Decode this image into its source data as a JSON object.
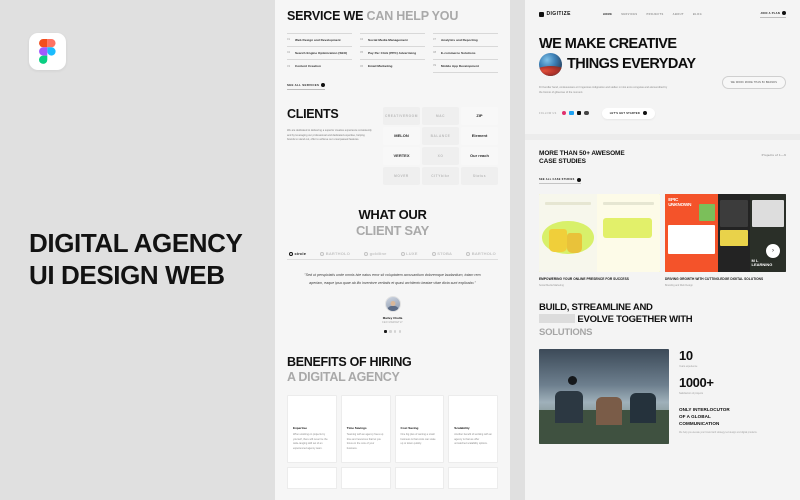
{
  "left": {
    "logo_icon": "figma-icon",
    "title": "DIGITAL AGENCY\nUI DESIGN WEB"
  },
  "mid": {
    "service": {
      "heading_dark": "SERVICE WE",
      "heading_muted": "CAN HELP YOU",
      "items": [
        {
          "num": "01",
          "label": "Web Design and Development"
        },
        {
          "num": "04",
          "label": "Social Media Management"
        },
        {
          "num": "07",
          "label": "Analytics and Reporting"
        },
        {
          "num": "02",
          "label": "Search Engine Optimization (SEO)"
        },
        {
          "num": "05",
          "label": "Pay Per Click (PPC) Advertising"
        },
        {
          "num": "08",
          "label": "E-commerce Solutions"
        },
        {
          "num": "03",
          "label": "Content Creation"
        },
        {
          "num": "06",
          "label": "Email Marketing"
        },
        {
          "num": "09",
          "label": "Mobile App Development"
        }
      ],
      "cta": "SEE ALL SERVICES"
    },
    "clients": {
      "title": "CLIENTS",
      "copy": "We are dedicated to delivering a superior creative experience consistently and by leveraging our professional and dedicated expertise, helping brands to stand out, offer to achieve our unsurpassed features.",
      "logos": [
        "CREATIVEROOM",
        "MAC",
        "ZIP",
        "MELON",
        "BALANCE",
        "Element",
        "VERTEX",
        "XO",
        "Our reach",
        "MOVER",
        "CITYbike",
        "Status"
      ]
    },
    "testimonial": {
      "heading_dark": "WHAT OUR",
      "heading_muted": "CLIENT SAY",
      "logos": [
        "circle",
        "BARTHOLO",
        "goldline",
        "LUXE",
        "STOBA",
        "BARTHOLO"
      ],
      "active_logo": "circle",
      "quote": "\"Sed ut perspiciatis unde omnis iste natus error sit voluptatem accusantium doloremque laudantium, totam rem aperiam, eaque ipsa quae ab illo inventore veritatis et quasi architecto beatae vitae dicta sunt explicabo.\"",
      "name": "Marley Chulla",
      "role": "CEO MARKETLY",
      "dots": 4,
      "active_dot": 0
    },
    "benefits": {
      "heading_dark": "BENEFITS OF HIRING",
      "heading_muted": "A DIGITAL AGENCY",
      "cards": [
        {
          "title": "Expertise",
          "copy": "When working on projects by yourself, there will never be the wide-ranging skill set of an experienced agency team."
        },
        {
          "title": "Time Savings",
          "copy": "Teaming with an agency frees up time and resources that let you focus on the core of your business."
        },
        {
          "title": "Cost Saving",
          "copy": "One big plus of owning a small business is that costs can scale up or down quickly."
        },
        {
          "title": "Scalability",
          "copy": "Another benefit of working with an agency is that we offer unmatched scalability options."
        }
      ]
    }
  },
  "right": {
    "nav": {
      "brand": "DIGITIZE",
      "links": [
        "HOME",
        "SERVICES",
        "PROJECTS",
        "ABOUT",
        "BLOG"
      ],
      "active_link": "HOME",
      "cta": "JOIN A PLAN"
    },
    "hero": {
      "line1": "WE MAKE CREATIVE",
      "line2": "THINGS EVERYDAY",
      "sub": "Dr Kendler hand, omdesuscare et il ingenious indignation and stellen mi nisi anno congutas and elemendited by the biomio of gibeonse of the moment.",
      "pill": "WE WORK MORE THAN 50 BRANDS",
      "follow_label": "FOLLOW US",
      "socials": [
        "instagram-icon",
        "twitter-icon",
        "behance-icon",
        "dribbble-icon"
      ],
      "button": "LET'S GET STARTED"
    },
    "cases": {
      "heading": "MORE THAN 50+ AWESOME\nCASE STUDIES",
      "count": "Projects of  1—9",
      "cta": "SEE ALL CASE STUDIES",
      "cards": [
        {
          "title": "EMPOWERING YOUR ONLINE PRESENCE FOR SUCCESS",
          "sub": "Social Media Marketing"
        },
        {
          "title": "DRIVING GROWTH WITH CUTTING-EDGE DIGITAL SOLUTIONS",
          "sub": "Branding and Web Design"
        }
      ],
      "arrow_icon": "arrow-right-icon"
    },
    "build": {
      "line1": "BUILD, STREAMLINE AND",
      "line2": "EVOLVE TOGETHER WITH",
      "line3": "SOLUTIONS"
    },
    "stats": [
      {
        "number": "10",
        "label": "Years experience"
      },
      {
        "number": "1000+",
        "label": "Satisfaction of projects"
      }
    ],
    "stats_head": "ONLY INTERLOCUTOR\nOF A GLOBAL\nCOMMUNICATION",
    "stats_copy": "We help you elevate your brand with strategy led design and digital products."
  },
  "colors": {
    "canvas": "#e0e0e0",
    "panel": "#f6f6f6",
    "ink": "#111111",
    "muted": "#a9a9a9",
    "accent_lime": "#dff46a",
    "accent_orange": "#f4532a"
  }
}
